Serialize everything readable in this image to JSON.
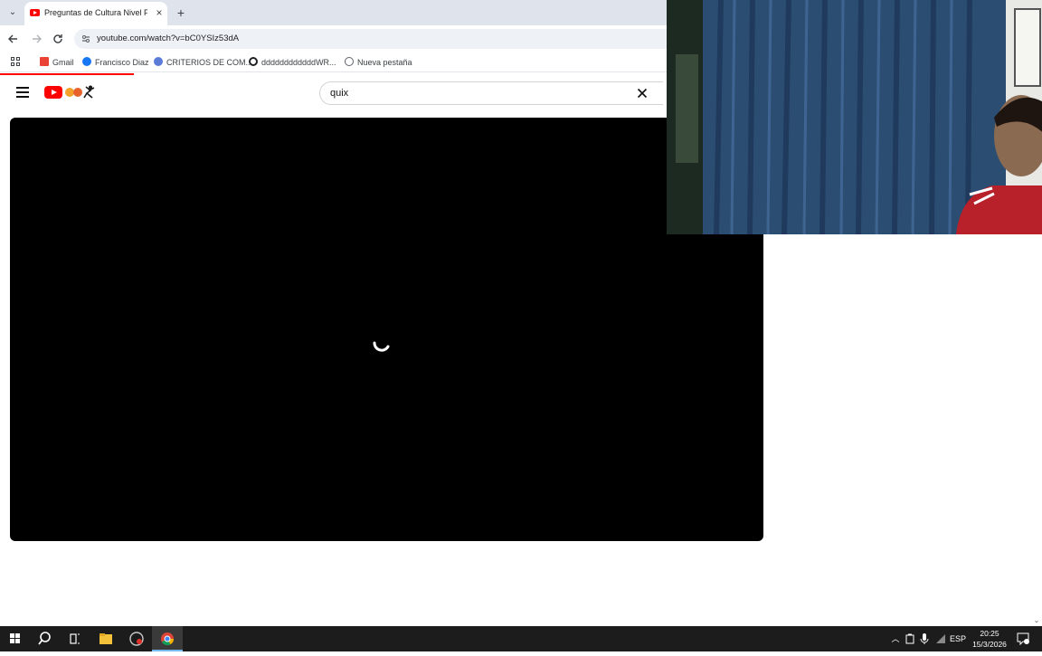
{
  "browser": {
    "tab": {
      "title": "Preguntas de Cultura Nivel Prin",
      "close": "×"
    },
    "new_tab": "+",
    "url": "youtube.com/watch?v=bC0YSIz53dA",
    "bookmarks": [
      {
        "label": "Gmail",
        "icon": "gmail-icon",
        "color": "#ea4335"
      },
      {
        "label": "Francisco Diaz",
        "icon": "facebook-icon",
        "color": "#1877f2"
      },
      {
        "label": "CRITERIOS DE COM...",
        "icon": "site-icon",
        "color": "#5a7bd8"
      },
      {
        "label": "ddddddddddddWR...",
        "icon": "site-icon",
        "color": "#202124"
      },
      {
        "label": "Nueva pestaña",
        "icon": "globe-icon",
        "color": "#5f6368"
      }
    ]
  },
  "youtube": {
    "search_query": "quix",
    "brand_color": "#ff0000",
    "player": {
      "state": "loading"
    }
  },
  "taskbar": {
    "items": [
      "start-icon",
      "search-icon",
      "task-view-icon",
      "file-explorer-icon",
      "app-icon",
      "chrome-icon"
    ],
    "language": "ESP",
    "time": "20:25",
    "date": "15/3/2026"
  }
}
